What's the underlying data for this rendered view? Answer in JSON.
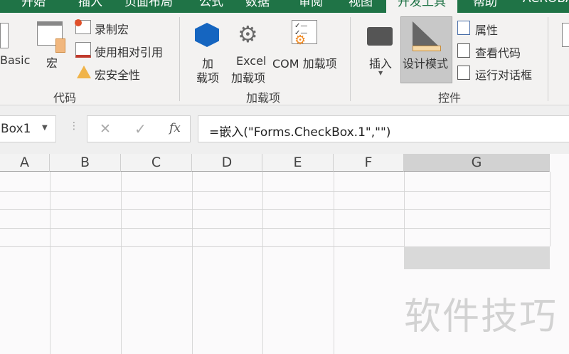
{
  "tabs": [
    "开始",
    "插入",
    "页面布局",
    "公式",
    "数据",
    "审阅",
    "视图",
    "开发工具",
    "帮助",
    "ACROBAT"
  ],
  "ribbon": {
    "code": {
      "visual_basic": "Basic",
      "macros": "宏",
      "record_macro": "录制宏",
      "relative_ref": "使用相对引用",
      "macro_security": "宏安全性",
      "group": "代码"
    },
    "addins": {
      "addins_l1": "加",
      "addins_l2": "载项",
      "excel_l1": "Excel",
      "excel_l2": "加载项",
      "com": "COM 加载项",
      "group": "加载项"
    },
    "controls": {
      "insert": "插入",
      "design_mode": "设计模式",
      "properties": "属性",
      "view_code": "查看代码",
      "run_dialog": "运行对话框",
      "group": "控件"
    }
  },
  "formula_bar": {
    "name_box": "Box1",
    "cancel": "✕",
    "enter": "✓",
    "fx": "fx",
    "formula": "=嵌入(\"Forms.CheckBox.1\",\"\")"
  },
  "columns": [
    "A",
    "B",
    "C",
    "D",
    "E",
    "F",
    "G"
  ],
  "watermark": "软件技巧"
}
